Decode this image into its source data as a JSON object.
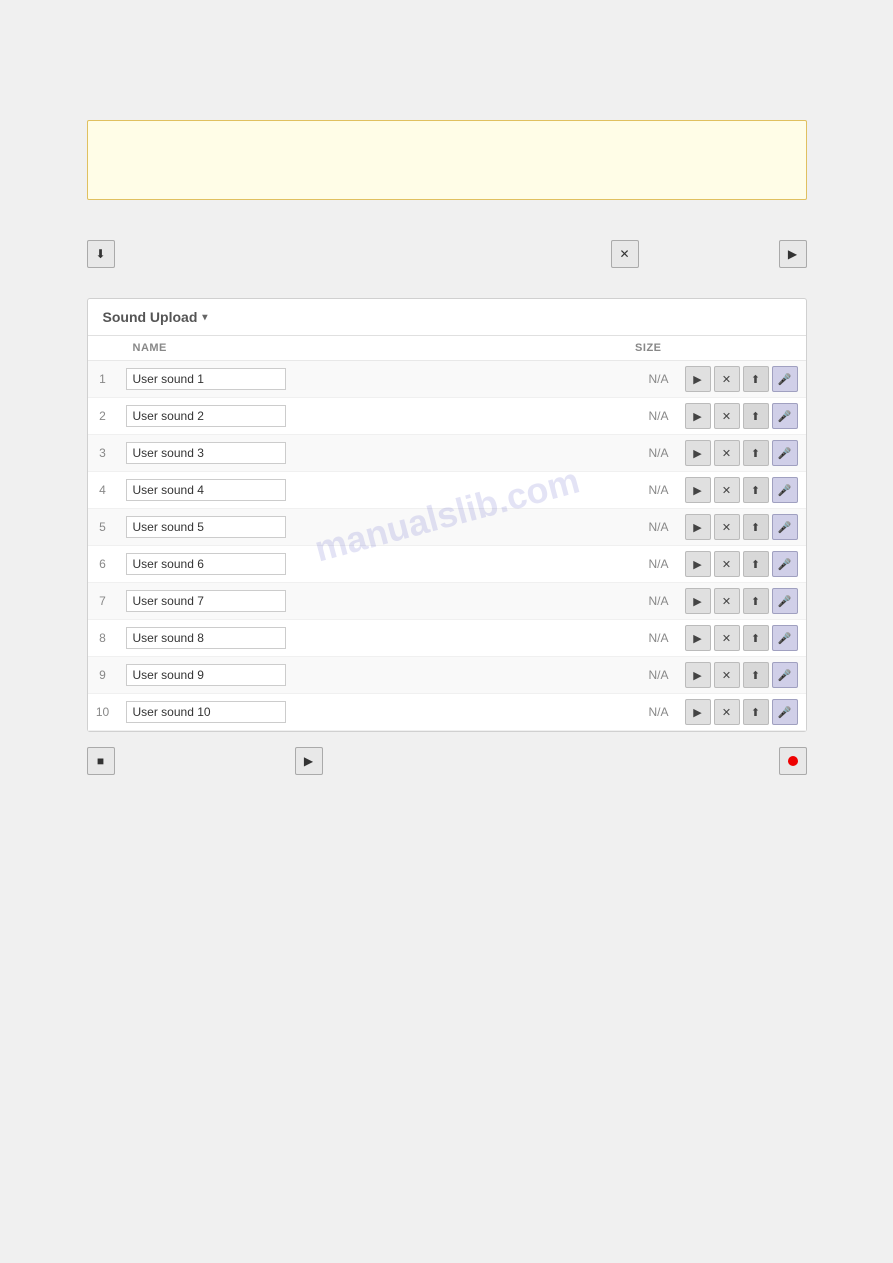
{
  "infoBox": {},
  "topControls": {
    "downloadIcon": "⬇",
    "closeIcon": "✕",
    "playIcon": "▶"
  },
  "soundSection": {
    "title": "Sound Upload",
    "chevron": "▾",
    "columns": {
      "name": "NAME",
      "size": "SIZE"
    },
    "sounds": [
      {
        "num": "1",
        "name": "User sound 1",
        "size": "N/A"
      },
      {
        "num": "2",
        "name": "User sound 2",
        "size": "N/A"
      },
      {
        "num": "3",
        "name": "User sound 3",
        "size": "N/A"
      },
      {
        "num": "4",
        "name": "User sound 4",
        "size": "N/A"
      },
      {
        "num": "5",
        "name": "User sound 5",
        "size": "N/A"
      },
      {
        "num": "6",
        "name": "User sound 6",
        "size": "N/A"
      },
      {
        "num": "7",
        "name": "User sound 7",
        "size": "N/A"
      },
      {
        "num": "8",
        "name": "User sound 8",
        "size": "N/A"
      },
      {
        "num": "9",
        "name": "User sound 9",
        "size": "N/A"
      },
      {
        "num": "10",
        "name": "User sound 10",
        "size": "N/A"
      }
    ]
  },
  "bottomControls": {
    "stopIcon": "■",
    "playIcon": "▶",
    "recordDot": "●"
  },
  "watermark": "manualslib.com"
}
